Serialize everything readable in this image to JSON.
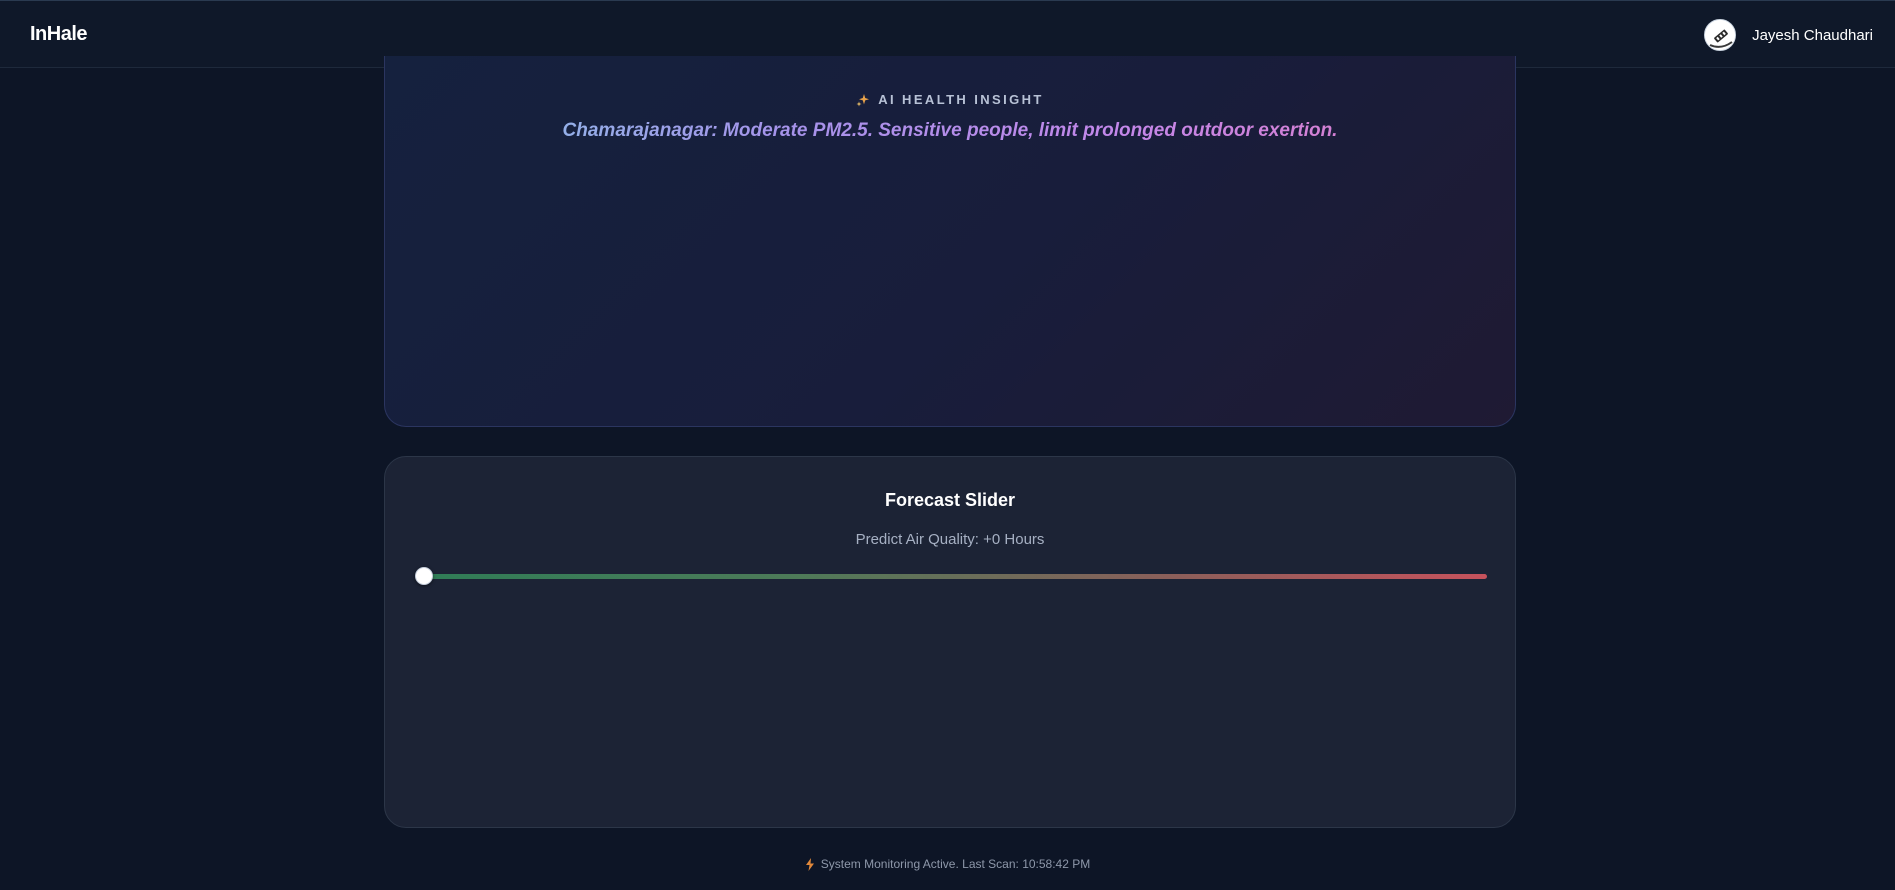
{
  "header": {
    "brand": "InHale",
    "user_name": "Jayesh Chaudhari",
    "avatar_icon": "user-avatar-icon"
  },
  "insight": {
    "label": "AI HEALTH INSIGHT",
    "icon": "sparkle-icon",
    "message": "Chamarajanagar: Moderate PM2.5. Sensitive people, limit prolonged outdoor exertion."
  },
  "forecast": {
    "title": "Forecast Slider",
    "subtitle": "Predict Air Quality: +0 Hours",
    "slider_value_fraction": 0,
    "colors": {
      "start": "#2f7d57",
      "end": "#c6525c"
    }
  },
  "footer": {
    "icon": "bolt-icon",
    "status": "System Monitoring Active. Last Scan: 10:58:42 PM"
  },
  "colors": {
    "background": "#0d1526",
    "card": "#1c2335",
    "accent_bolt": "#e0883a"
  }
}
